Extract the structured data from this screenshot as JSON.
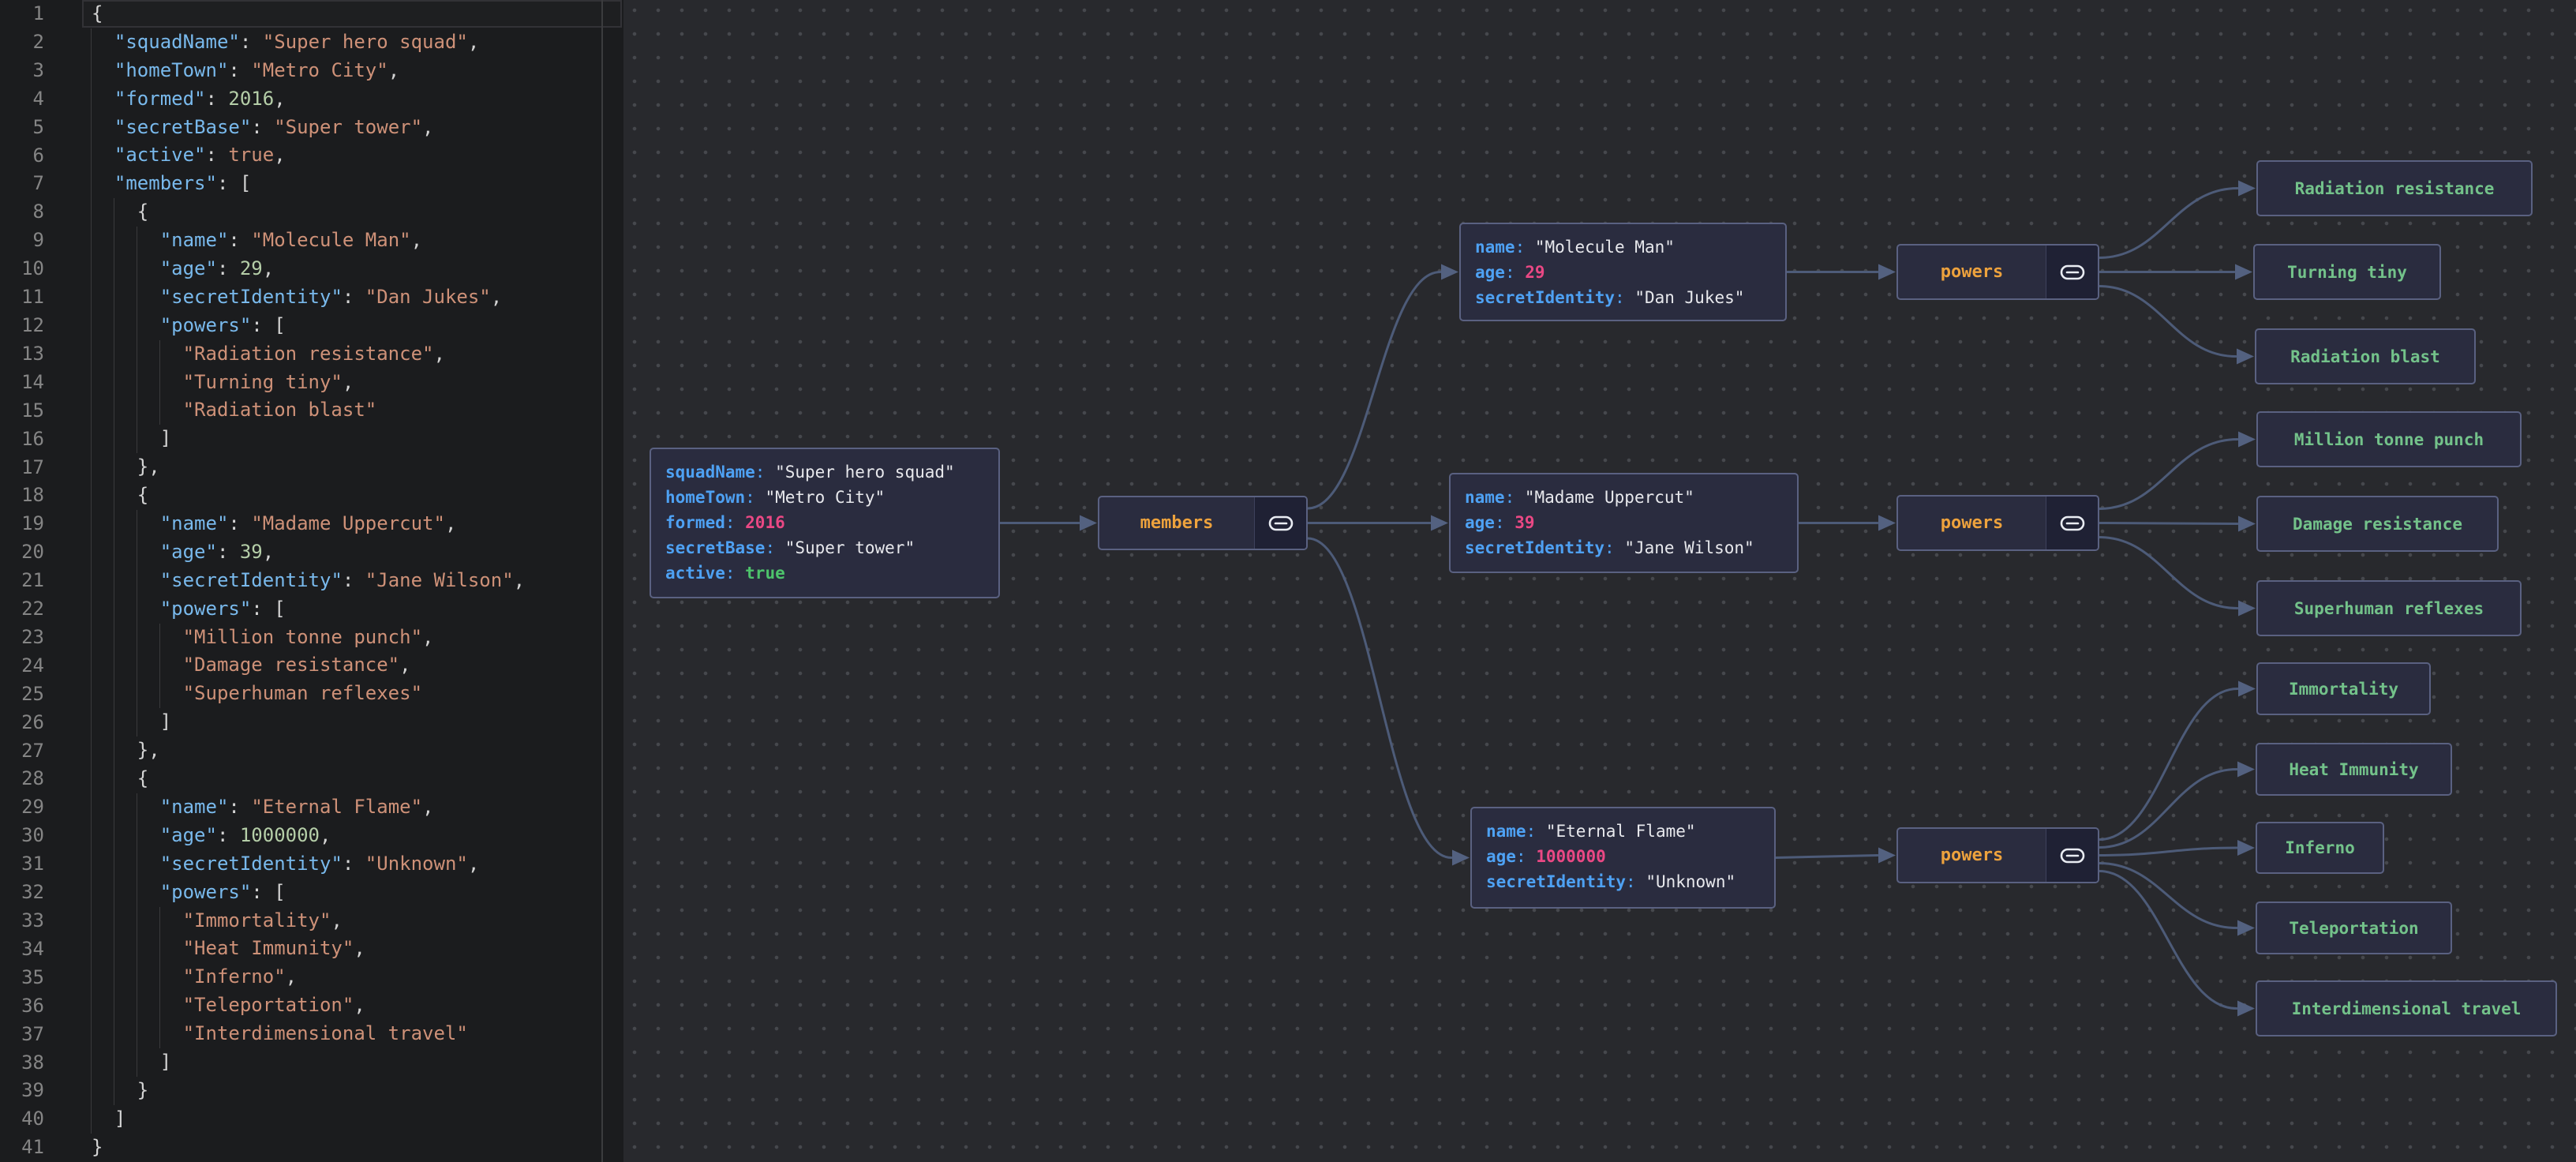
{
  "editor": {
    "line_count": 41,
    "current_line": 1,
    "lines": [
      "{",
      "  \"squadName\": \"Super hero squad\",",
      "  \"homeTown\": \"Metro City\",",
      "  \"formed\": 2016,",
      "  \"secretBase\": \"Super tower\",",
      "  \"active\": true,",
      "  \"members\": [",
      "    {",
      "      \"name\": \"Molecule Man\",",
      "      \"age\": 29,",
      "      \"secretIdentity\": \"Dan Jukes\",",
      "      \"powers\": [",
      "        \"Radiation resistance\",",
      "        \"Turning tiny\",",
      "        \"Radiation blast\"",
      "      ]",
      "    },",
      "    {",
      "      \"name\": \"Madame Uppercut\",",
      "      \"age\": 39,",
      "      \"secretIdentity\": \"Jane Wilson\",",
      "      \"powers\": [",
      "        \"Million tonne punch\",",
      "        \"Damage resistance\",",
      "        \"Superhuman reflexes\"",
      "      ]",
      "    },",
      "    {",
      "      \"name\": \"Eternal Flame\",",
      "      \"age\": 1000000,",
      "      \"secretIdentity\": \"Unknown\",",
      "      \"powers\": [",
      "        \"Immortality\",",
      "        \"Heat Immunity\",",
      "        \"Inferno\",",
      "        \"Teleportation\",",
      "        \"Interdimensional travel\"",
      "      ]",
      "    }",
      "  ]",
      "}"
    ]
  },
  "graph": {
    "root": {
      "fields": [
        {
          "key": "squadName",
          "value": "Super hero squad",
          "type": "string"
        },
        {
          "key": "homeTown",
          "value": "Metro City",
          "type": "string"
        },
        {
          "key": "formed",
          "value": "2016",
          "type": "number"
        },
        {
          "key": "secretBase",
          "value": "Super tower",
          "type": "string"
        },
        {
          "key": "active",
          "value": "true",
          "type": "boolean"
        }
      ]
    },
    "members_label": "members",
    "powers_label": "powers",
    "members": [
      {
        "fields": [
          {
            "key": "name",
            "value": "Molecule Man",
            "type": "string"
          },
          {
            "key": "age",
            "value": "29",
            "type": "number"
          },
          {
            "key": "secretIdentity",
            "value": "Dan Jukes",
            "type": "string"
          }
        ],
        "powers": [
          "Radiation resistance",
          "Turning tiny",
          "Radiation blast"
        ]
      },
      {
        "fields": [
          {
            "key": "name",
            "value": "Madame Uppercut",
            "type": "string"
          },
          {
            "key": "age",
            "value": "39",
            "type": "number"
          },
          {
            "key": "secretIdentity",
            "value": "Jane Wilson",
            "type": "string"
          }
        ],
        "powers": [
          "Million tonne punch",
          "Damage resistance",
          "Superhuman reflexes"
        ]
      },
      {
        "fields": [
          {
            "key": "name",
            "value": "Eternal Flame",
            "type": "string"
          },
          {
            "key": "age",
            "value": "1000000",
            "type": "number"
          },
          {
            "key": "secretIdentity",
            "value": "Unknown",
            "type": "string"
          }
        ],
        "powers": [
          "Immortality",
          "Heat Immunity",
          "Inferno",
          "Teleportation",
          "Interdimensional travel"
        ]
      }
    ],
    "icons": {
      "link": "link-icon"
    }
  },
  "colors": {
    "editor_bg": "#1b1c1e",
    "graph_bg": "#28292d",
    "dot": "#46484d",
    "line_number": "#858585",
    "ed_key": "#79b9ec",
    "ed_string": "#ce9178",
    "ed_number": "#b5cea8",
    "ed_bool": "#ce9178",
    "ed_punct": "#d4d4d4",
    "guide": "#3a3a3c",
    "ruler": "#3b3c3e",
    "current_line_border": "#323236",
    "node_bg": "#2a2c3f",
    "node_border": "#5a6181",
    "icon_bg": "#1f2134",
    "divider": "#3e415c",
    "g_key": "#4ea1f3",
    "g_value": "#e8e9ed",
    "g_number": "#ea4884",
    "g_bool": "#4dc36b",
    "g_label": "#eda23d",
    "g_leaf": "#73c28a",
    "edge": "#4d5b78",
    "arrow": "#536180",
    "icon": "#e9ecf2"
  }
}
